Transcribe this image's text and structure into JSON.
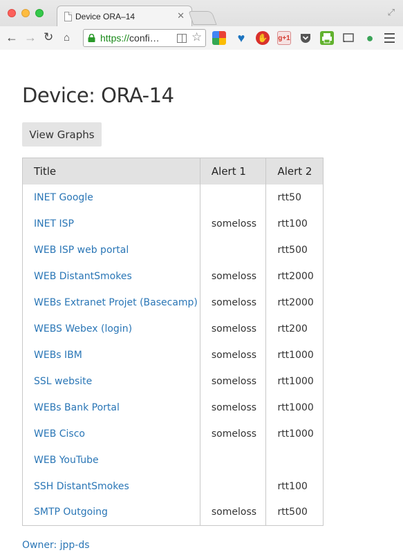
{
  "browser": {
    "tab_title": "Device ORA–14",
    "url_scheme": "https://",
    "url_host": "confi…"
  },
  "page": {
    "title": "Device: ORA-14",
    "graphs_button": "View Graphs",
    "table": {
      "headers": [
        "Title",
        "Alert 1",
        "Alert 2"
      ],
      "rows": [
        {
          "title": "INET Google",
          "alert1": "",
          "alert2": "rtt50"
        },
        {
          "title": "INET ISP",
          "alert1": "someloss",
          "alert2": "rtt100"
        },
        {
          "title": "WEB ISP web portal",
          "alert1": "",
          "alert2": "rtt500"
        },
        {
          "title": "WEB DistantSmokes",
          "alert1": "someloss",
          "alert2": "rtt2000"
        },
        {
          "title": "WEBs Extranet Projet (Basecamp)",
          "alert1": "someloss",
          "alert2": "rtt2000"
        },
        {
          "title": "WEBS Webex (login)",
          "alert1": "someloss",
          "alert2": "rtt200"
        },
        {
          "title": "WEBs IBM",
          "alert1": "someloss",
          "alert2": "rtt1000"
        },
        {
          "title": "SSL website",
          "alert1": "someloss",
          "alert2": "rtt1000"
        },
        {
          "title": "WEBs Bank Portal",
          "alert1": "someloss",
          "alert2": "rtt1000"
        },
        {
          "title": "WEB Cisco",
          "alert1": "someloss",
          "alert2": "rtt1000"
        },
        {
          "title": "WEB YouTube",
          "alert1": "",
          "alert2": ""
        },
        {
          "title": "SSH DistantSmokes",
          "alert1": "",
          "alert2": "rtt100"
        },
        {
          "title": "SMTP Outgoing",
          "alert1": "someloss",
          "alert2": "rtt500"
        }
      ]
    },
    "owner": "Owner: jpp-ds"
  },
  "colors": {
    "link": "#2a76b6",
    "header_bg": "#e2e2e2",
    "button_bg": "#e4e4e4"
  }
}
